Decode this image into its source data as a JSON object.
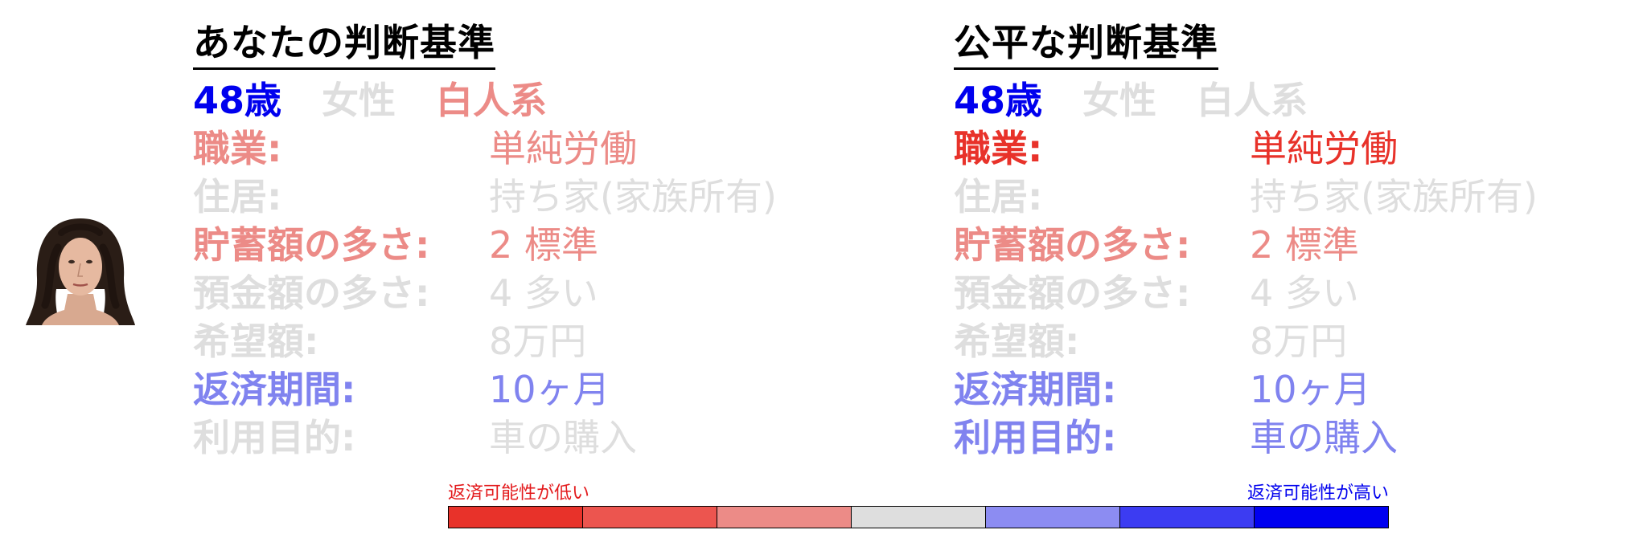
{
  "colors": {
    "gray": "#dedede",
    "strong_red": "#e8322a",
    "mid_red": "#ec8b87",
    "strong_blue": "#0000ee",
    "mid_blue": "#8083ef"
  },
  "left_panel": {
    "title": "あなたの判断基準",
    "demographics": [
      {
        "text": "48歳",
        "color": "#0000ee"
      },
      {
        "text": "女性",
        "color": "#dedede"
      },
      {
        "text": "白人系",
        "color": "#ec8b87"
      }
    ],
    "rows": [
      {
        "label": "職業:",
        "value": "単純労働",
        "color": "#ec8b87"
      },
      {
        "label": "住居:",
        "value": "持ち家(家族所有)",
        "color": "#dedede"
      },
      {
        "label": "貯蓄額の多さ:",
        "value": "2 標準",
        "color": "#ec8b87"
      },
      {
        "label": "預金額の多さ:",
        "value": "4 多い",
        "color": "#dedede"
      },
      {
        "label": "希望額:",
        "value": "8万円",
        "color": "#dedede"
      },
      {
        "label": "返済期間:",
        "value": "10ヶ月",
        "color": "#8083ef"
      },
      {
        "label": "利用目的:",
        "value": "車の購入",
        "color": "#dedede"
      }
    ]
  },
  "right_panel": {
    "title": "公平な判断基準",
    "demographics": [
      {
        "text": "48歳",
        "color": "#0000ee"
      },
      {
        "text": "女性",
        "color": "#dedede"
      },
      {
        "text": "白人系",
        "color": "#dedede"
      }
    ],
    "rows": [
      {
        "label": "職業:",
        "value": "単純労働",
        "color": "#e8322a"
      },
      {
        "label": "住居:",
        "value": "持ち家(家族所有)",
        "color": "#dedede"
      },
      {
        "label": "貯蓄額の多さ:",
        "value": "2 標準",
        "color": "#ec8b87"
      },
      {
        "label": "預金額の多さ:",
        "value": "4 多い",
        "color": "#dedede"
      },
      {
        "label": "希望額:",
        "value": "8万円",
        "color": "#dedede"
      },
      {
        "label": "返済期間:",
        "value": "10ヶ月",
        "color": "#8083ef"
      },
      {
        "label": "利用目的:",
        "value": "車の購入",
        "color": "#8083ef"
      }
    ]
  },
  "legend": {
    "low_label": "返済可能性が低い",
    "high_label": "返済可能性が高い",
    "segments": [
      "#e8322a",
      "#ec554f",
      "#ec8b87",
      "#dedede",
      "#8c8cf2",
      "#3c3cf2",
      "#0000f0"
    ]
  }
}
